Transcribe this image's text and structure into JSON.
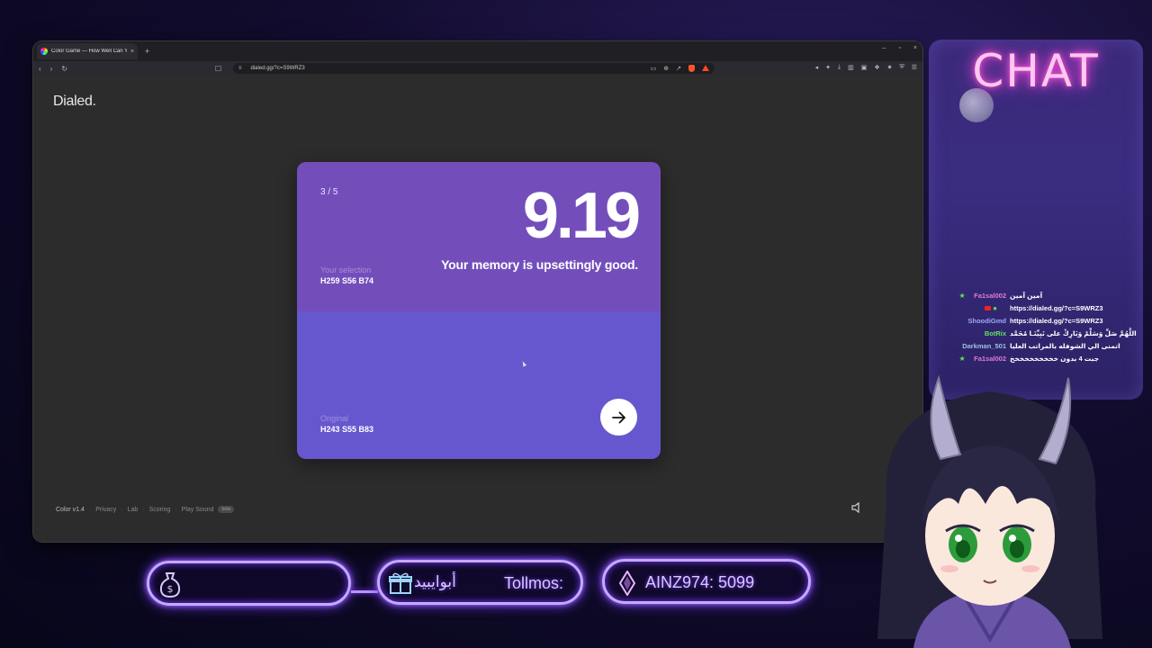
{
  "browser": {
    "tab_title": "Color Game — How Well Can Y",
    "tab_close": "×",
    "new_tab": "+",
    "url": "dialed.gg/?c=S9WRZ3",
    "win_controls": [
      "–",
      "▫",
      "×"
    ]
  },
  "page": {
    "logo": "Dialed.",
    "round": "3 / 5",
    "score": "9.19",
    "verdict": "Your memory is upsettingly good.",
    "selection": {
      "label": "Your selection",
      "value": "H259 S56 B74",
      "color": "#734ebb"
    },
    "original": {
      "label": "Original",
      "value": "H243 S55 B83",
      "color": "#6657cf"
    },
    "next_icon": "arrow-right-icon",
    "footer": {
      "version": "Color v1.4",
      "links": [
        "Privacy",
        "Lab",
        "Scoring",
        "Play Sound"
      ],
      "sep": "·",
      "badge": "beta"
    }
  },
  "chat": {
    "title": "CHAT",
    "messages": [
      {
        "user": "Fa1sal002",
        "user_color": "#e07ad6",
        "badge": "star",
        "text": "آمين آمين"
      },
      {
        "user": "",
        "user_color": "#888888",
        "badge": "yt",
        "text": "https://dialed.gg/?c=S9WRZ3"
      },
      {
        "user": "ShoodiGmd",
        "user_color": "#9fa8ff",
        "badge": "",
        "text": "https://dialed.gg/?c=S9WRZ3"
      },
      {
        "user": "BotRix",
        "user_color": "#5fe35f",
        "badge": "",
        "text": "اللَّهُمَّ صَلِّ وَسَلِّمْ وَبَارِكْ على نَبِيِّنَـا مُحَمَّد"
      },
      {
        "user": "Darkman_501",
        "user_color": "#9fc0e0",
        "badge": "",
        "text": "اتمنى الي الشوفله بالمراتب العليا"
      },
      {
        "user": "Fa1sal002",
        "user_color": "#e07ad6",
        "badge": "star",
        "text": "جبت 4 بدون خخخخخخخخخخ"
      }
    ]
  },
  "widgets": {
    "donation_icon": "money-bag-icon",
    "follower_icon": "gift-icon",
    "follower_name": "أبوايبيد",
    "follow_label": "Tollmos:",
    "sub_icon": "diamond-icon",
    "sub_text": "AINZ974: 5099"
  }
}
